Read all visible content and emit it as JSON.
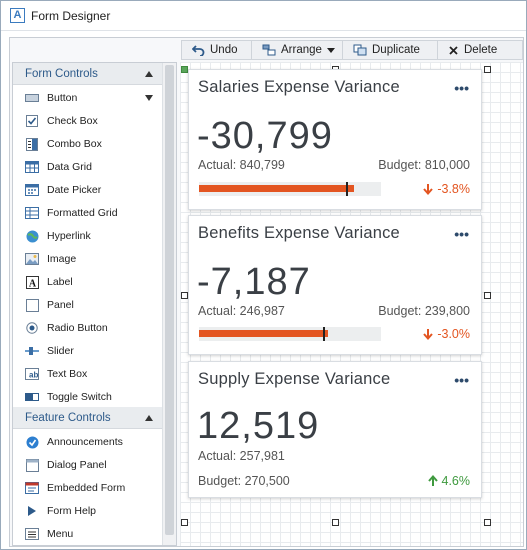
{
  "window": {
    "title": "Form Designer",
    "app_icon_letter": "A"
  },
  "toolbar": {
    "undo_label": "Undo",
    "arrange_label": "Arrange",
    "duplicate_label": "Duplicate",
    "delete_label": "Delete"
  },
  "sidebar": {
    "form_controls_header": "Form Controls",
    "form_controls": [
      {
        "label": "Button",
        "icon": "button-icon"
      },
      {
        "label": "Check Box",
        "icon": "checkbox-icon"
      },
      {
        "label": "Combo Box",
        "icon": "combo-box-icon"
      },
      {
        "label": "Data Grid",
        "icon": "data-grid-icon"
      },
      {
        "label": "Date Picker",
        "icon": "date-picker-icon"
      },
      {
        "label": "Formatted Grid",
        "icon": "formatted-grid-icon"
      },
      {
        "label": "Hyperlink",
        "icon": "hyperlink-icon"
      },
      {
        "label": "Image",
        "icon": "image-icon"
      },
      {
        "label": "Label",
        "icon": "label-icon"
      },
      {
        "label": "Panel",
        "icon": "panel-icon"
      },
      {
        "label": "Radio Button",
        "icon": "radio-button-icon"
      },
      {
        "label": "Slider",
        "icon": "slider-icon"
      },
      {
        "label": "Text Box",
        "icon": "text-box-icon"
      },
      {
        "label": "Toggle Switch",
        "icon": "toggle-switch-icon"
      }
    ],
    "feature_controls_header": "Feature Controls",
    "feature_controls": [
      {
        "label": "Announcements",
        "icon": "announcements-icon"
      },
      {
        "label": "Dialog Panel",
        "icon": "dialog-panel-icon"
      },
      {
        "label": "Embedded Form",
        "icon": "embedded-form-icon"
      },
      {
        "label": "Form Help",
        "icon": "form-help-icon"
      },
      {
        "label": "Menu",
        "icon": "menu-icon"
      }
    ]
  },
  "cards": [
    {
      "title": "Salaries Expense Variance",
      "menu": "•••",
      "value": "-30,799",
      "actual": "Actual: 840,799",
      "budget": "Budget: 810,000",
      "variance": "-3.8%",
      "direction": "down",
      "bar_fill_fraction": 0.85,
      "bar_marker_fraction": 0.81
    },
    {
      "title": "Benefits Expense Variance",
      "menu": "•••",
      "value": "-7,187",
      "actual": "Actual: 246,987",
      "budget": "Budget: 239,800",
      "variance": "-3.0%",
      "direction": "down",
      "bar_fill_fraction": 0.71,
      "bar_marker_fraction": 0.68
    },
    {
      "title": "Supply Expense Variance",
      "menu": "•••",
      "value": "12,519",
      "actual": "Actual: 257,981",
      "budget": "Budget: 270,500",
      "variance": "4.6%",
      "direction": "up"
    }
  ],
  "colors": {
    "negative": "#e35521",
    "positive": "#3f9a3f",
    "header_text": "#2d5a8a"
  }
}
